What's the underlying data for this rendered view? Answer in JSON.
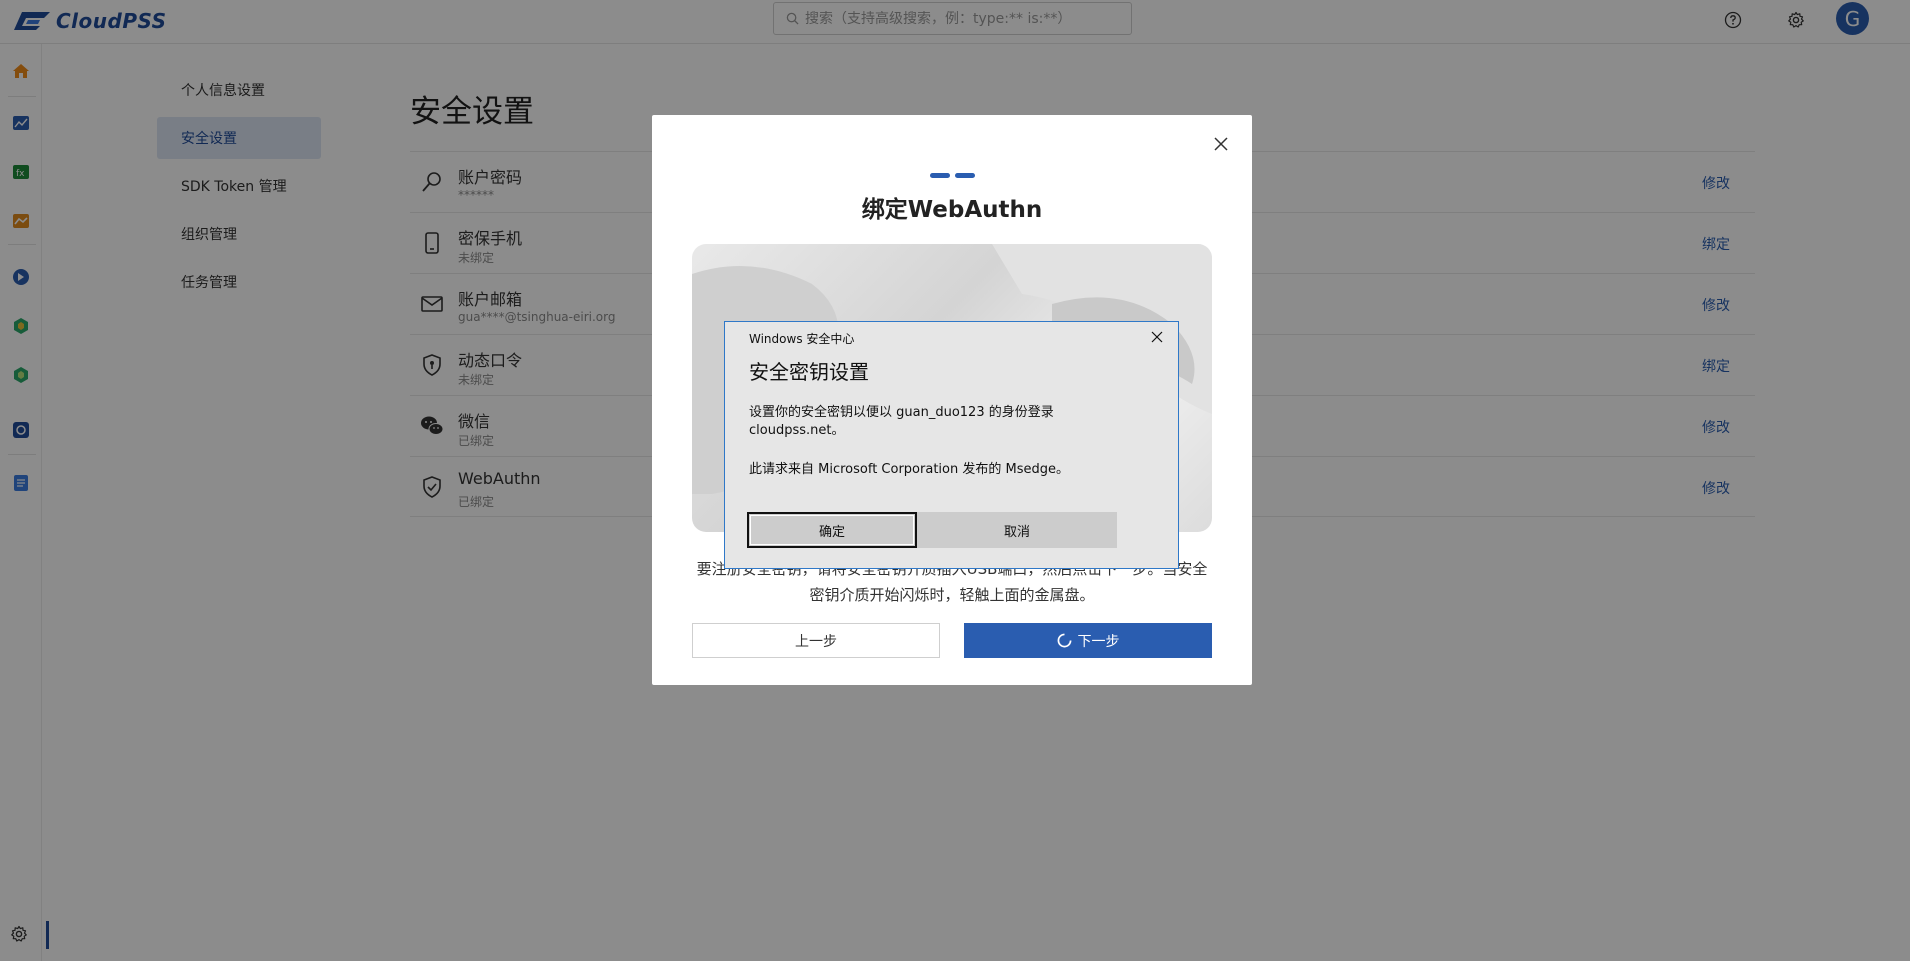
{
  "app": {
    "brand": "CloudPSS"
  },
  "search": {
    "placeholder": "搜索（支持高级搜索，例：type:** is:**）"
  },
  "user": {
    "avatar_letter": "G"
  },
  "icons": {
    "help": "help-circle-icon",
    "settings": "gear-icon",
    "rail": [
      "home-icon",
      "chart-app-icon",
      "function-app-icon",
      "analysis-app-icon",
      "model-app-icon",
      "hex-app-icon",
      "hex-app-icon-2",
      "sim-app-icon",
      "doc-app-icon"
    ]
  },
  "colors": {
    "brand": "#2a5db0",
    "menu_active_bg": "#dde6f4"
  },
  "settings_menu": {
    "items": [
      {
        "label": "个人信息设置"
      },
      {
        "label": "安全设置"
      },
      {
        "label": "SDK Token 管理"
      },
      {
        "label": "组织管理"
      },
      {
        "label": "任务管理"
      }
    ],
    "active_index": 1
  },
  "security": {
    "title": "安全设置",
    "rows": [
      {
        "icon": "key-search-icon",
        "title": "账户密码",
        "sub": "******",
        "action": "修改"
      },
      {
        "icon": "phone-icon",
        "title": "密保手机",
        "sub": "未绑定",
        "action": "绑定"
      },
      {
        "icon": "mail-icon",
        "title": "账户邮箱",
        "sub": "gua****@tsinghua-eiri.org",
        "action": "修改"
      },
      {
        "icon": "shield-key-icon",
        "title": "动态口令",
        "sub": "未绑定",
        "action": "绑定"
      },
      {
        "icon": "wechat-icon",
        "title": "微信",
        "sub": "已绑定",
        "action": "修改"
      },
      {
        "icon": "shield-check-icon",
        "title": "WebAuthn",
        "sub": "已绑定",
        "action": "修改"
      }
    ]
  },
  "modal": {
    "title": "绑定WebAuthn",
    "step": 2,
    "total_steps": 2,
    "description": "要注册安全密钥，请将安全密钥介质插入USB端口，然后点击下一步。当安全密钥介质开始闪烁时，轻触上面的金属盘。",
    "prev_label": "上一步",
    "next_label": "下一步"
  },
  "windows_dialog": {
    "caption": "Windows 安全中心",
    "heading": "安全密钥设置",
    "body_line1": "设置你的安全密钥以便以 guan_duo123 的身份登录",
    "body_line2": "cloudpss.net。",
    "body2": "此请求来自 Microsoft Corporation 发布的 Msedge。",
    "ok_label": "确定",
    "cancel_label": "取消"
  }
}
